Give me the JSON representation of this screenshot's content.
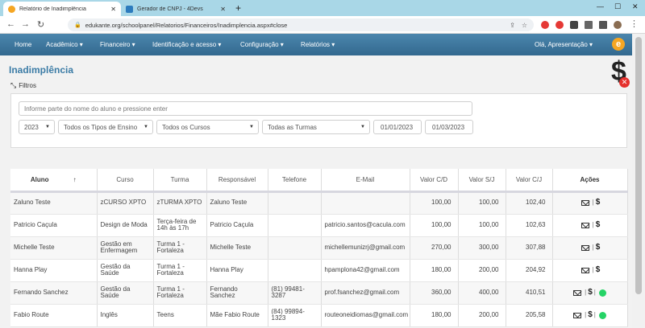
{
  "browser": {
    "tabs": [
      {
        "title": "Relatório de Inadimplência",
        "active": true
      },
      {
        "title": "Gerador de CNPJ - 4Devs",
        "active": false
      }
    ],
    "url": "edukante.org/schoolpanel/Relatorios/Financeiros/Inadimplencia.aspx#close"
  },
  "nav": {
    "items": [
      "Home",
      "Acadêmico ▾",
      "Financeiro ▾",
      "Identificação e acesso ▾",
      "Configuração ▾",
      "Relatórios ▾"
    ],
    "user": "Olá, Apresentação ▾",
    "logo_letter": "e"
  },
  "page": {
    "title": "Inadimplência",
    "filters_label": "Filtros"
  },
  "filters": {
    "search_placeholder": "Informe parte do nome do aluno e pressione enter",
    "year": "2023",
    "ensino": "Todos os Tipos de Ensino",
    "cursos": "Todos os Cursos",
    "turmas": "Todas as Turmas",
    "date_from": "01/01/2023",
    "date_to": "01/03/2023"
  },
  "table": {
    "headers": [
      "Aluno",
      "Curso",
      "Turma",
      "Responsável",
      "Telefone",
      "E-Mail",
      "Valor C/D",
      "Valor S/J",
      "Valor C/J",
      "Ações"
    ],
    "sort_arrow": "↑",
    "rows": [
      {
        "aluno": "Zaluno Teste",
        "curso": "zCURSO XPTO",
        "turma": "zTURMA XPTO",
        "responsavel": "Zaluno Teste",
        "telefone": "",
        "email": "",
        "cd": "100,00",
        "sj": "100,00",
        "cj": "102,40",
        "whatsapp": false
      },
      {
        "aluno": "Patricio Caçula",
        "curso": "Design de Moda",
        "turma": "Terça-feira de 14h às 17h",
        "responsavel": "Patricio Caçula",
        "telefone": "",
        "email": "patricio.santos@cacula.com",
        "cd": "100,00",
        "sj": "100,00",
        "cj": "102,63",
        "whatsapp": false
      },
      {
        "aluno": "Michelle Teste",
        "curso": "Gestão em Enfermagem",
        "turma": "Turma 1 - Fortaleza",
        "responsavel": "Michelle Teste",
        "telefone": "",
        "email": "michellemunizrj@gmail.com",
        "cd": "270,00",
        "sj": "300,00",
        "cj": "307,88",
        "whatsapp": false
      },
      {
        "aluno": "Hanna Play",
        "curso": "Gestão da Saúde",
        "turma": "Turma 1 - Fortaleza",
        "responsavel": "Hanna Play",
        "telefone": "",
        "email": "hpamplona42@gmail.com",
        "cd": "180,00",
        "sj": "200,00",
        "cj": "204,92",
        "whatsapp": false
      },
      {
        "aluno": "Fernando Sanchez",
        "curso": "Gestão da Saúde",
        "turma": "Turma 1 - Fortaleza",
        "responsavel": "Fernando Sanchez",
        "telefone": "(81) 99481-3287",
        "email": "prof.fsanchez@gmail.com",
        "cd": "360,00",
        "sj": "400,00",
        "cj": "410,51",
        "whatsapp": true
      },
      {
        "aluno": "Fabio Route",
        "curso": "Inglês",
        "turma": "Teens",
        "responsavel": "Mãe Fabio Route",
        "telefone": "(84) 99894-1323",
        "email": "routeoneidiomas@gmail.com",
        "cd": "180,00",
        "sj": "200,00",
        "cj": "205,58",
        "whatsapp": true
      }
    ]
  },
  "colors": {
    "navbar": "#3b749b",
    "title": "#3c7ca6",
    "accent": "#f5a623",
    "whatsapp": "#25d366",
    "danger": "#e5302c"
  }
}
